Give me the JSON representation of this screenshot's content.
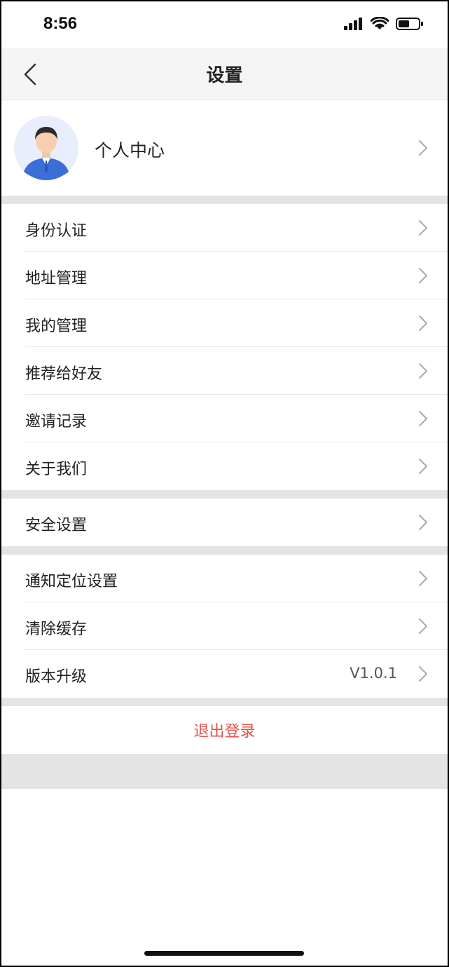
{
  "status_bar": {
    "time": "8:56",
    "icons": [
      "signal-icon",
      "wifi-icon",
      "battery-icon"
    ]
  },
  "nav": {
    "title": "设置",
    "back_icon": "chevron-left-icon"
  },
  "profile": {
    "label": "个人中心",
    "avatar": "avatar"
  },
  "group1": [
    {
      "label": "身份认证"
    },
    {
      "label": "地址管理"
    },
    {
      "label": "我的管理"
    },
    {
      "label": "推荐给好友"
    },
    {
      "label": "邀请记录"
    },
    {
      "label": "关于我们"
    }
  ],
  "group2": [
    {
      "label": "安全设置"
    }
  ],
  "group3": [
    {
      "label": "通知定位设置"
    },
    {
      "label": "清除缓存"
    },
    {
      "label": "版本升级",
      "value": "V1.0.1"
    }
  ],
  "logout": {
    "label": "退出登录"
  },
  "colors": {
    "logout": "#e0534a",
    "separator": "#e4e4e4",
    "nav_bg": "#f5f5f5"
  }
}
